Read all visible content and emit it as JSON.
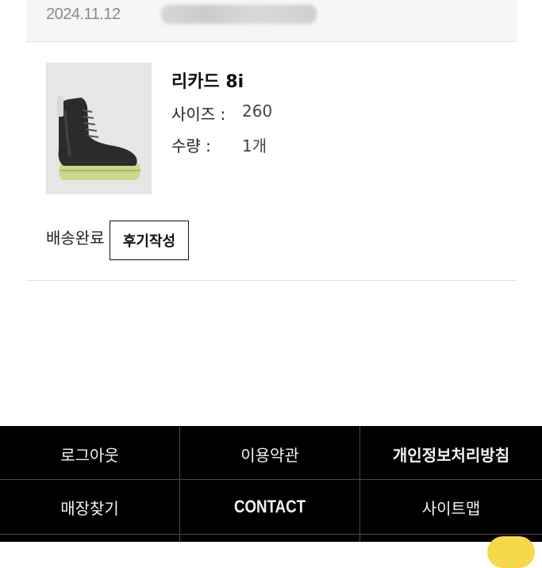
{
  "order": {
    "date": "2024.11.12"
  },
  "product": {
    "name": "리카드 8i",
    "size_label": "사이즈 :",
    "size_value": "260",
    "qty_label": "수량 :",
    "qty_value": "1개",
    "image_icon": "boot-product-image"
  },
  "status": {
    "text": "배송완료",
    "review_button": "후기작성"
  },
  "footer": {
    "links": [
      {
        "label": "로그아웃"
      },
      {
        "label": "이용약관"
      },
      {
        "label": "개인정보처리방침"
      },
      {
        "label": "매장찾기"
      },
      {
        "label": "CONTACT"
      },
      {
        "label": "사이트맵"
      }
    ]
  },
  "colors": {
    "footer_bg": "#000000",
    "chat_bubble": "#f6d84a"
  }
}
